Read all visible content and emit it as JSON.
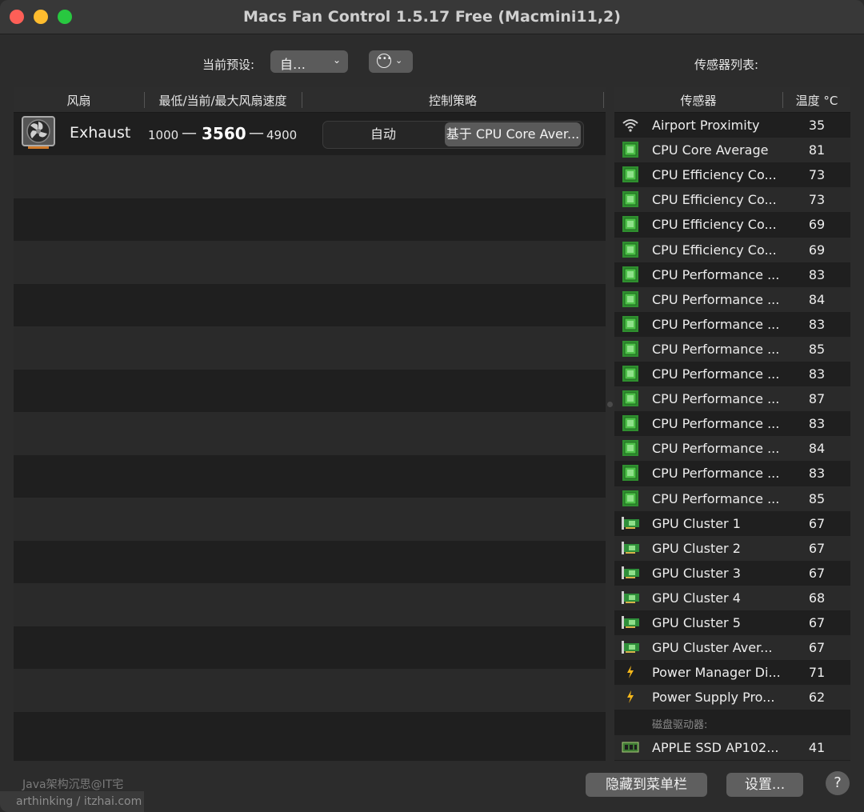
{
  "window": {
    "title": "Macs Fan Control 1.5.17 Free (Macmini11,2)"
  },
  "toolbar": {
    "preset_label": "当前预设:",
    "preset_value": "自…",
    "sensor_list_label": "传感器列表:"
  },
  "fan_table": {
    "headers": [
      "风扇",
      "最低/当前/最大风扇速度",
      "控制策略"
    ],
    "fans": [
      {
        "name": "Exhaust",
        "min": "1000",
        "dash": "—",
        "current": "3560",
        "max": "4900",
        "control_auto": "自动",
        "control_custom": "基于 CPU Core Aver..."
      }
    ]
  },
  "sensor_table": {
    "headers": [
      "传感器",
      "温度 °C"
    ],
    "rows": [
      {
        "icon": "wifi-icon",
        "name": "Airport Proximity",
        "value": "35"
      },
      {
        "icon": "cpu-chip-icon",
        "name": "CPU Core Average",
        "value": "81"
      },
      {
        "icon": "cpu-chip-icon",
        "name": "CPU Efficiency Co...",
        "value": "73"
      },
      {
        "icon": "cpu-chip-icon",
        "name": "CPU Efficiency Co...",
        "value": "73"
      },
      {
        "icon": "cpu-chip-icon",
        "name": "CPU Efficiency Co...",
        "value": "69"
      },
      {
        "icon": "cpu-chip-icon",
        "name": "CPU Efficiency Co...",
        "value": "69"
      },
      {
        "icon": "cpu-chip-icon",
        "name": "CPU Performance ...",
        "value": "83"
      },
      {
        "icon": "cpu-chip-icon",
        "name": "CPU Performance ...",
        "value": "84"
      },
      {
        "icon": "cpu-chip-icon",
        "name": "CPU Performance ...",
        "value": "83"
      },
      {
        "icon": "cpu-chip-icon",
        "name": "CPU Performance ...",
        "value": "85"
      },
      {
        "icon": "cpu-chip-icon",
        "name": "CPU Performance ...",
        "value": "83"
      },
      {
        "icon": "cpu-chip-icon",
        "name": "CPU Performance ...",
        "value": "87"
      },
      {
        "icon": "cpu-chip-icon",
        "name": "CPU Performance ...",
        "value": "83"
      },
      {
        "icon": "cpu-chip-icon",
        "name": "CPU Performance ...",
        "value": "84"
      },
      {
        "icon": "cpu-chip-icon",
        "name": "CPU Performance ...",
        "value": "83"
      },
      {
        "icon": "cpu-chip-icon",
        "name": "CPU Performance ...",
        "value": "85"
      },
      {
        "icon": "gpu-card-icon",
        "name": "GPU Cluster 1",
        "value": "67"
      },
      {
        "icon": "gpu-card-icon",
        "name": "GPU Cluster 2",
        "value": "67"
      },
      {
        "icon": "gpu-card-icon",
        "name": "GPU Cluster 3",
        "value": "67"
      },
      {
        "icon": "gpu-card-icon",
        "name": "GPU Cluster 4",
        "value": "68"
      },
      {
        "icon": "gpu-card-icon",
        "name": "GPU Cluster 5",
        "value": "67"
      },
      {
        "icon": "gpu-card-icon",
        "name": "GPU Cluster Aver...",
        "value": "67"
      },
      {
        "icon": "lightning-icon",
        "name": "Power Manager Di...",
        "value": "71"
      },
      {
        "icon": "lightning-icon",
        "name": "Power Supply Pro...",
        "value": "62"
      }
    ],
    "disk_group_label": "磁盘驱动器:",
    "disk_rows": [
      {
        "icon": "ssd-icon",
        "name": "APPLE SSD AP102...",
        "value": "41"
      }
    ]
  },
  "footer": {
    "hide_to_menubar": "隐藏到菜单栏",
    "settings": "设置...",
    "help": "?"
  },
  "watermark": {
    "line1": "Java架构沉思@IT宅",
    "line2": "arthinking / itzhai.com"
  }
}
